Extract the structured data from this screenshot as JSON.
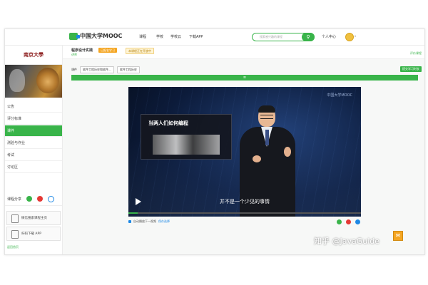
{
  "colors": {
    "accent": "#39b44a",
    "sidebar_active": "#39b44a",
    "link": "#1e88e5"
  },
  "header": {
    "logo_text": "中国大学MOOC",
    "nav": [
      "课程",
      "学校",
      "学校云",
      "下载APP"
    ],
    "search_placeholder": "搜索感兴趣的课程",
    "search_icon": "search-icon",
    "user_center": "个人中心"
  },
  "sidebar": {
    "school_name": "南京大學",
    "items": [
      "公告",
      "评分标准",
      "课件",
      "测验与作业",
      "考试",
      "讨论区"
    ],
    "active_index": 2,
    "share_label": "课程分享",
    "promos": [
      "微信搜索课程主页",
      "扫码下载 APP"
    ],
    "back_label": "返回首页"
  },
  "course": {
    "name": "程序设计实践",
    "sub": "讲师",
    "tag1": "已报名学习",
    "tag2": "本课程正在开放中",
    "rate": "评价课程"
  },
  "breadcrumbs": {
    "prefix": "课件",
    "select1": "软件工程历史和软件...",
    "select2": "软件工程历史"
  },
  "next_button": "提交学习时长",
  "progress_bar_label": "≡",
  "video": {
    "panel_title": "当两人们如何编程",
    "watermark": "中国大学MOOC",
    "subtitle": "并不是一个少见的事情",
    "progress": 0.04
  },
  "below_video": {
    "option": "自动播放下一视频",
    "option2": "保存选择"
  },
  "watermark_overlay": "知乎 @JavaGuide"
}
